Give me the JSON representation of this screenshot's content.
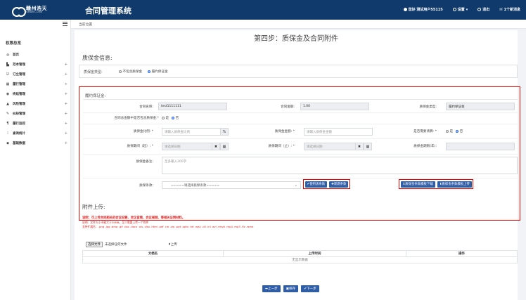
{
  "app": {
    "logo_cn": "赣州浩天",
    "logo_en": "SMART-CHN",
    "title": "合同管理系统"
  },
  "topbar": {
    "user": "您好 测试用户55115",
    "settings": "设置",
    "logout": "退出",
    "messages": "1个新消息"
  },
  "sidebar": {
    "heading": "权限总览",
    "items": [
      {
        "icon": "home-icon",
        "glyph": "⌂",
        "label": "首页",
        "expandable": false
      },
      {
        "icon": "document-icon",
        "glyph": "▙",
        "label": "范本管理",
        "expandable": true
      },
      {
        "icon": "order-icon",
        "glyph": "☑",
        "label": "订立管理",
        "expandable": true
      },
      {
        "icon": "calendar-icon",
        "glyph": "▦",
        "label": "履行管理",
        "expandable": true
      },
      {
        "icon": "stop-icon",
        "glyph": "◉",
        "label": "终结管理",
        "expandable": true
      },
      {
        "icon": "warning-icon",
        "glyph": "▲",
        "label": "风险管理",
        "expandable": true
      },
      {
        "icon": "wrench-icon",
        "glyph": "✎",
        "label": "纠纷管理",
        "expandable": true
      },
      {
        "icon": "audit-icon",
        "glyph": "¶",
        "label": "履行监控",
        "expandable": true
      },
      {
        "icon": "chart-icon",
        "glyph": "⫶",
        "label": "查询统计",
        "expandable": true
      },
      {
        "icon": "database-icon",
        "glyph": "◆",
        "label": "基础数据",
        "expandable": true
      }
    ]
  },
  "breadcrumb": "当前位置",
  "step_title": "第四步：质保金及合同附件",
  "qbz": {
    "section_title": "质保金信息:",
    "type_label": "质保金类型:",
    "options": [
      {
        "label": "不包含质保金",
        "checked": false
      },
      {
        "label": "履约保证金",
        "checked": true
      }
    ]
  },
  "lybz": {
    "heading": "履约保证金:",
    "contract_name_label": "合同名称:",
    "contract_name_value": "test1111111",
    "contract_amount_label": "合同金额:",
    "contract_amount_value": "1.00",
    "type_label": "质保金类型:",
    "type_value": "履约保证金",
    "include_label": "合同总金额中是否包含质保金:*",
    "include_options": [
      {
        "label": "是",
        "checked": false
      },
      {
        "label": "否",
        "checked": true
      }
    ],
    "ratio_label": "质保金比例: *",
    "ratio_placeholder": "请输入质保金比例",
    "ratio_unit": "%",
    "amount_label": "质保金金额: *",
    "amount_placeholder": "请输入质保金金额",
    "cash_label": "是否需要清算: *",
    "cash_options": [
      {
        "label": "是",
        "checked": false
      },
      {
        "label": "否",
        "checked": true
      }
    ],
    "period_start_label": "质保期间（起）: *",
    "period_start_placeholder": "请选择日期",
    "period_end_label": "质保期间（止）: *",
    "period_end_placeholder": "请选择日期",
    "years_label": "质保金期限(年):",
    "remark_label": "质保金备注:",
    "remark_placeholder": "至多输入300字",
    "terms_label": "质保条款:",
    "terms_select": "=====请选择质保条款=====",
    "use_terms_button": "使用该条款",
    "new_terms_button": "新建条款",
    "download_template_button": "质保金条款模板下载",
    "upload_template_button": "质保金条款模板上传"
  },
  "attachment": {
    "title": "附件上传:",
    "note1": "说明：可上传合同相关的会议纪要、会议音频、会议视频、等相关证明材料。",
    "note2": "说明：文件大小不能大于35MB，至少需要上传一个附件",
    "note3": "支持扩展名：.png .jpg .bmp .gif .doc .docx .xls .xlsx .html .pdf .rar .zip .ppt .pptx .txt .wav .dll .ini .avi .rmvb .mp4 .mp3 .flv .wma",
    "choose_button": "选择文件",
    "no_file": "未选择任何文件",
    "upload_button": "上传",
    "columns": [
      "文档名",
      "上传时间",
      "操作"
    ],
    "empty_text": "无显示数据"
  },
  "footer_buttons": {
    "prev": "上一步",
    "save": "保存",
    "next": "下一步"
  }
}
